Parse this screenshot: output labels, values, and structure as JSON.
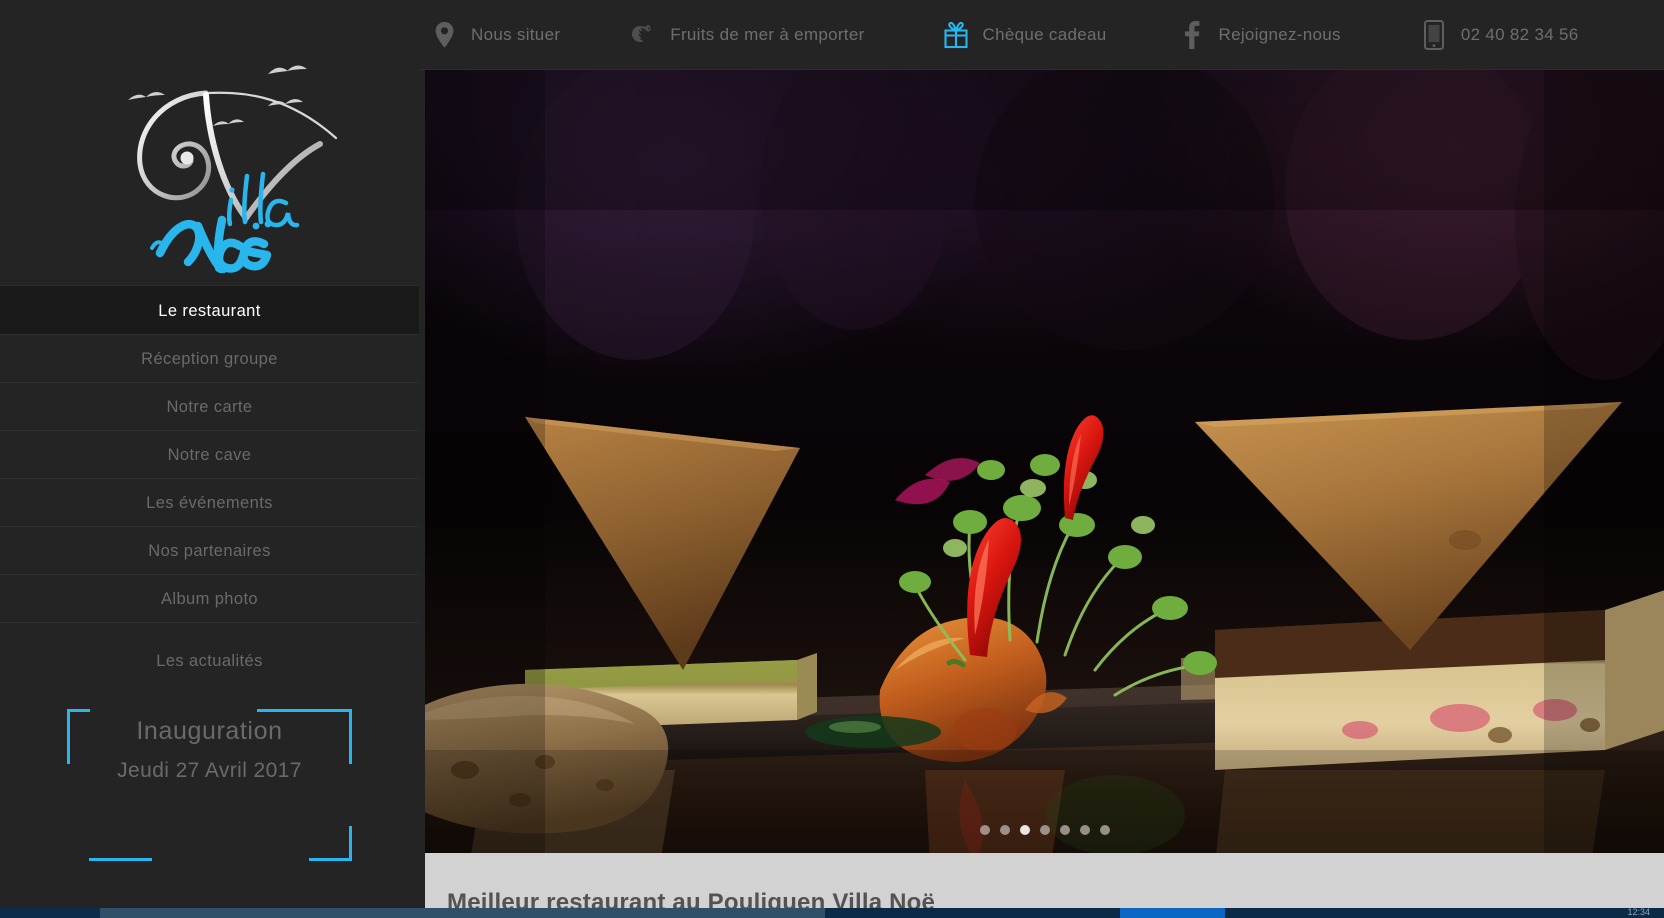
{
  "site": {
    "brand_script_top": "Villa",
    "brand_script_bottom": "Noë",
    "accent_color": "#29b6ec",
    "sidebar_bg": "#242424",
    "active_nav_bg": "#1a1a1a"
  },
  "topbar": {
    "items": [
      {
        "label": "Nous situer",
        "icon": "location-pin-icon",
        "accent": false
      },
      {
        "label": "Fruits de mer à emporter",
        "icon": "shrimp-icon",
        "accent": false
      },
      {
        "label": "Chèque cadeau",
        "icon": "gift-icon",
        "accent": true
      },
      {
        "label": "Rejoignez-nous",
        "icon": "facebook-icon",
        "accent": false
      },
      {
        "label": "02 40 82 34 56",
        "icon": "mobile-phone-icon",
        "accent": false
      }
    ]
  },
  "sidebar": {
    "nav": [
      {
        "label": "Le restaurant",
        "active": true
      },
      {
        "label": "Réception groupe",
        "active": false
      },
      {
        "label": "Notre carte",
        "active": false
      },
      {
        "label": "Notre cave",
        "active": false
      },
      {
        "label": "Les événements",
        "active": false
      },
      {
        "label": "Nos partenaires",
        "active": false
      },
      {
        "label": "Album photo",
        "active": false
      }
    ],
    "news_label": "Les actualités",
    "promo": {
      "title": "Inauguration",
      "subtitle": "Jeudi 27 Avril 2017"
    }
  },
  "hero": {
    "alt": "Assiette de foie gras et pain sur ardoise",
    "slider": {
      "total_dots": 7,
      "active_index": 3
    }
  },
  "below": {
    "title": "Meilleur restaurant au Pouliguen Villa Noë"
  },
  "taskbar": {
    "clock": "12:34"
  }
}
